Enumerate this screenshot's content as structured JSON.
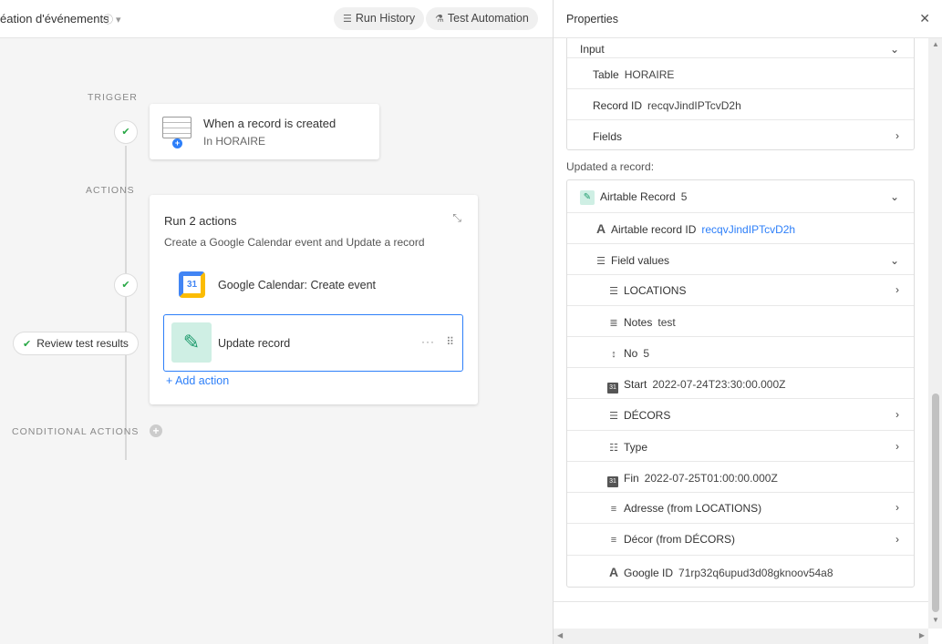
{
  "topbar": {
    "title": "éation d'événements",
    "run_history": "Run History",
    "test_automation": "Test Automation"
  },
  "canvas": {
    "trigger_label": "TRIGGER",
    "actions_label": "ACTIONS",
    "conditional_label": "CONDITIONAL ACTIONS",
    "trigger": {
      "title": "When a record is created",
      "subtitle": "In HORAIRE"
    },
    "actions_card": {
      "title": "Run 2 actions",
      "description": "Create a Google Calendar event and Update a record",
      "gcal_day": "31",
      "action1": "Google Calendar: Create event",
      "action2": "Update record",
      "add_action": "Add action"
    },
    "review_button": "Review test results"
  },
  "panel": {
    "title": "Properties",
    "input": {
      "header": "Input",
      "table_label": "Table",
      "table_value": "HORAIRE",
      "record_id_label": "Record ID",
      "record_id_value": "recqvJindIPTcvD2h",
      "fields_label": "Fields"
    },
    "updated_label": "Updated a record:",
    "record": {
      "header": "Airtable Record",
      "header_count": "5",
      "record_id_label": "Airtable record ID",
      "record_id_value": "recqvJindIPTcvD2h",
      "field_values_label": "Field values",
      "fields": [
        {
          "name": "LOCATIONS",
          "value": "",
          "icon": "multi-select-icon"
        },
        {
          "name": "Notes",
          "value": "test",
          "icon": "long-text-icon"
        },
        {
          "name": "No",
          "value": "5",
          "icon": "number-icon"
        },
        {
          "name": "Start",
          "value": "2022-07-24T23:30:00.000Z",
          "icon": "calendar-icon"
        },
        {
          "name": "DÉCORS",
          "value": "",
          "icon": "multi-select-icon"
        },
        {
          "name": "Type",
          "value": "",
          "icon": "checklist-icon"
        },
        {
          "name": "Fin",
          "value": "2022-07-25T01:00:00.000Z",
          "icon": "calendar-icon"
        },
        {
          "name": "Adresse (from LOCATIONS)",
          "value": "",
          "icon": "lookup-icon"
        },
        {
          "name": "Décor (from DÉCORS)",
          "value": "",
          "icon": "lookup-icon"
        },
        {
          "name": "Google ID",
          "value": "71rp32q6upud3d08gknoov54a8",
          "icon": "text-icon"
        }
      ]
    }
  },
  "colors": {
    "accent": "#2d7ff9",
    "success": "#28a745",
    "update_icon_bg": "#cfefe4"
  }
}
